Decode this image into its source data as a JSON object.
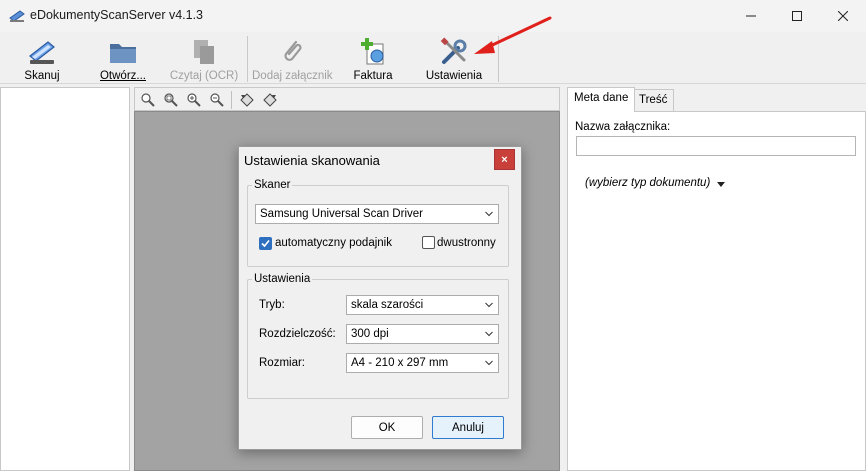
{
  "window": {
    "title": "eDokumentyScanServer v4.1.3",
    "min_glyph": "—",
    "max_glyph": "☐",
    "close_glyph": "✕"
  },
  "toolbar": {
    "scan_label": "Skanuj",
    "open_label": "Otwórz...",
    "ocr_label": "Czytaj (OCR)",
    "attach_label": "Dodaj załącznik",
    "invoice_label": "Faktura",
    "settings_label": "Ustawienia"
  },
  "right_panel": {
    "tab_meta": "Meta dane",
    "tab_content": "Treść",
    "attachment_name_label": "Nazwa załącznika:",
    "attachment_name_value": "",
    "doc_type_placeholder": "(wybierz typ dokumentu)"
  },
  "dialog": {
    "title": "Ustawienia skanowania",
    "close_glyph": "×",
    "scanner_group": "Skaner",
    "scanner_value": "Samsung Universal Scan Driver",
    "auto_feeder_label": "automatyczny podajnik",
    "auto_feeder_checked": true,
    "duplex_label": "dwustronny",
    "duplex_checked": false,
    "settings_group": "Ustawienia",
    "mode_label": "Tryb:",
    "mode_value": "skala szarości",
    "resolution_label": "Rozdzielczość:",
    "resolution_value": "300 dpi",
    "size_label": "Rozmiar:",
    "size_value": "A4 - 210 x 297 mm",
    "ok_label": "OK",
    "cancel_label": "Anuluj"
  },
  "colors": {
    "accent": "#2f6fbf",
    "close_red": "#c9403a",
    "arrow_red": "#e0201b",
    "viewer_bg": "#a3a3a3"
  }
}
